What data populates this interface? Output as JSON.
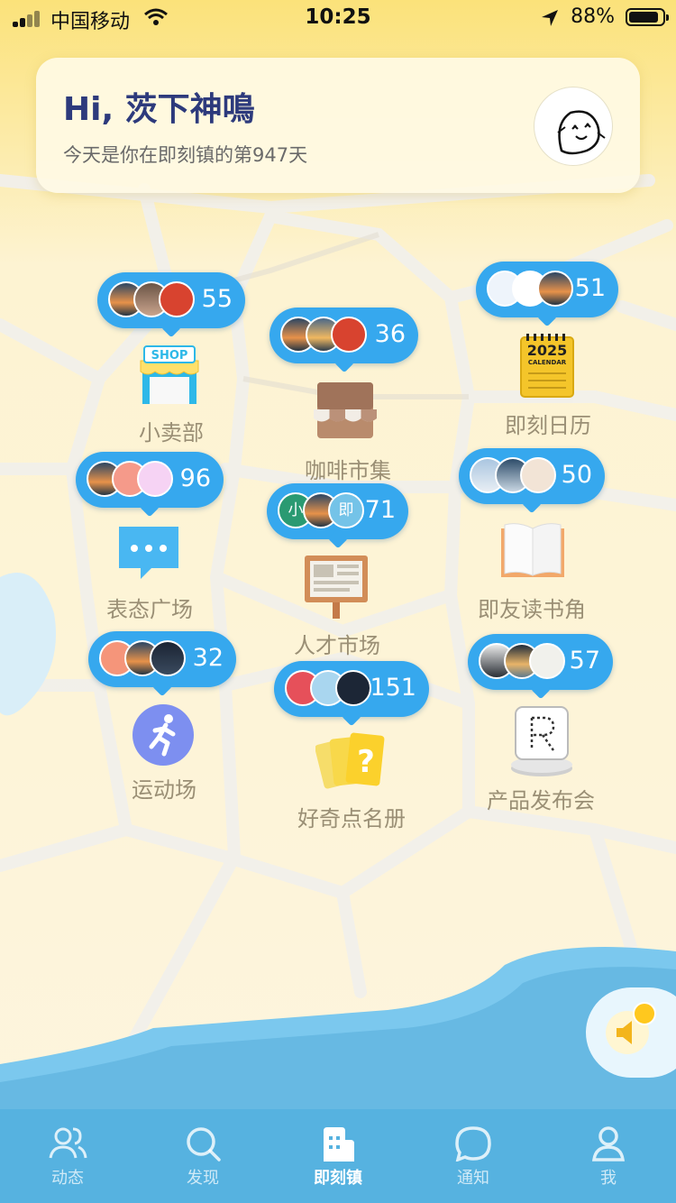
{
  "status_bar": {
    "carrier": "中国移动",
    "time": "10:25",
    "battery": "88%",
    "battery_level": 0.88
  },
  "greeting": {
    "title": "Hi, 茨下神鳴",
    "subtitle": "今天是你在即刻镇的第947天"
  },
  "places": [
    {
      "name": "小卖部",
      "count": "55",
      "icon": "shop-icon",
      "avatar_texts": [
        "",
        "",
        ""
      ]
    },
    {
      "name": "咖啡市集",
      "count": "36",
      "icon": "coffee-stall-icon",
      "avatar_texts": [
        "",
        "",
        ""
      ]
    },
    {
      "name": "即刻日历",
      "count": "51",
      "icon": "calendar-icon",
      "icon_texts": [
        "2025",
        "CALENDAR"
      ],
      "avatar_texts": [
        "",
        "",
        ""
      ]
    },
    {
      "name": "表态广场",
      "count": "96",
      "icon": "speech-bubble-icon",
      "avatar_texts": [
        "",
        "",
        ""
      ]
    },
    {
      "name": "即友读书角",
      "count": "50",
      "icon": "book-icon",
      "avatar_texts": [
        "",
        "",
        ""
      ]
    },
    {
      "name": "人才市场",
      "count": "71",
      "icon": "notice-board-icon",
      "avatar_texts": [
        "小",
        "",
        "即"
      ]
    },
    {
      "name": "运动场",
      "count": "32",
      "icon": "runner-icon",
      "avatar_texts": [
        "",
        "",
        ""
      ]
    },
    {
      "name": "好奇点名册",
      "count": "151",
      "icon": "question-cards-icon",
      "avatar_texts": [
        "",
        "",
        ""
      ]
    },
    {
      "name": "产品发布会",
      "count": "57",
      "icon": "product-launch-icon",
      "avatar_texts": [
        "",
        "",
        ""
      ]
    }
  ],
  "tabs": [
    {
      "label": "动态",
      "icon": "users-icon",
      "active": false
    },
    {
      "label": "发现",
      "icon": "search-icon",
      "active": false
    },
    {
      "label": "即刻镇",
      "icon": "town-icon",
      "active": true
    },
    {
      "label": "通知",
      "icon": "chat-bubble-icon",
      "active": false
    },
    {
      "label": "我",
      "icon": "profile-icon",
      "active": false
    }
  ],
  "colors": {
    "bubble": "#36a8ee",
    "tab_bar": "#56b2e0",
    "title": "#2d3a7c",
    "sea": "#6cc2ea"
  }
}
